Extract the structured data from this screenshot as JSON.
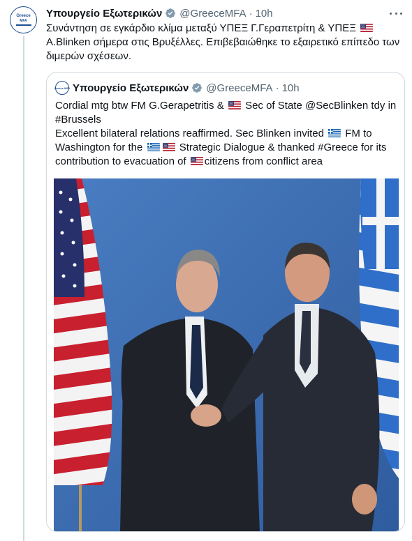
{
  "tweet": {
    "author_name": "Υπουργείο Εξωτερικών",
    "handle": "@GreeceMFA",
    "separator": "·",
    "time": "10h",
    "avatar_text_1": "Greece",
    "avatar_text_2": "MFA",
    "text_1": "Συνάντηση σε εγκάρδιο κλίμα μεταξύ ΥΠΕΞ Γ.Γεραπετρίτη & ΥΠΕΞ",
    "text_2": "Α.Blinken σήμερα στις Βρυξέλλες. Επιβεβαιώθηκε το εξαιρετικό επίπεδο των διμερών σχέσεων."
  },
  "quote": {
    "author_name": "Υπουργείο Εξωτερικών",
    "handle": "@GreeceMFA",
    "separator": "·",
    "time": "10h",
    "avatar_text": "Greece MFA",
    "line1_a": "Cordial mtg btw FM G.Gerapetritis &",
    "line1_b": "Sec of State @SecBlinken tdy in #Brussels",
    "line2_a": "Excellent bilateral relations reaffirmed. Sec Blinken invited",
    "line2_b": "FM to Washington for the",
    "line2_c": "Strategic Dialogue & thanked #Greece for its contribution to evacuation of",
    "line2_d": "citizens from conflict area"
  },
  "colors": {
    "text": "#0f1419",
    "secondary": "#536471",
    "border": "#cfd9de",
    "verified": "#829aab",
    "photo_background": "#3f72b8"
  },
  "icons": [
    "verified-badge-icon",
    "more-options-icon",
    "us-flag-icon",
    "greek-flag-icon"
  ]
}
